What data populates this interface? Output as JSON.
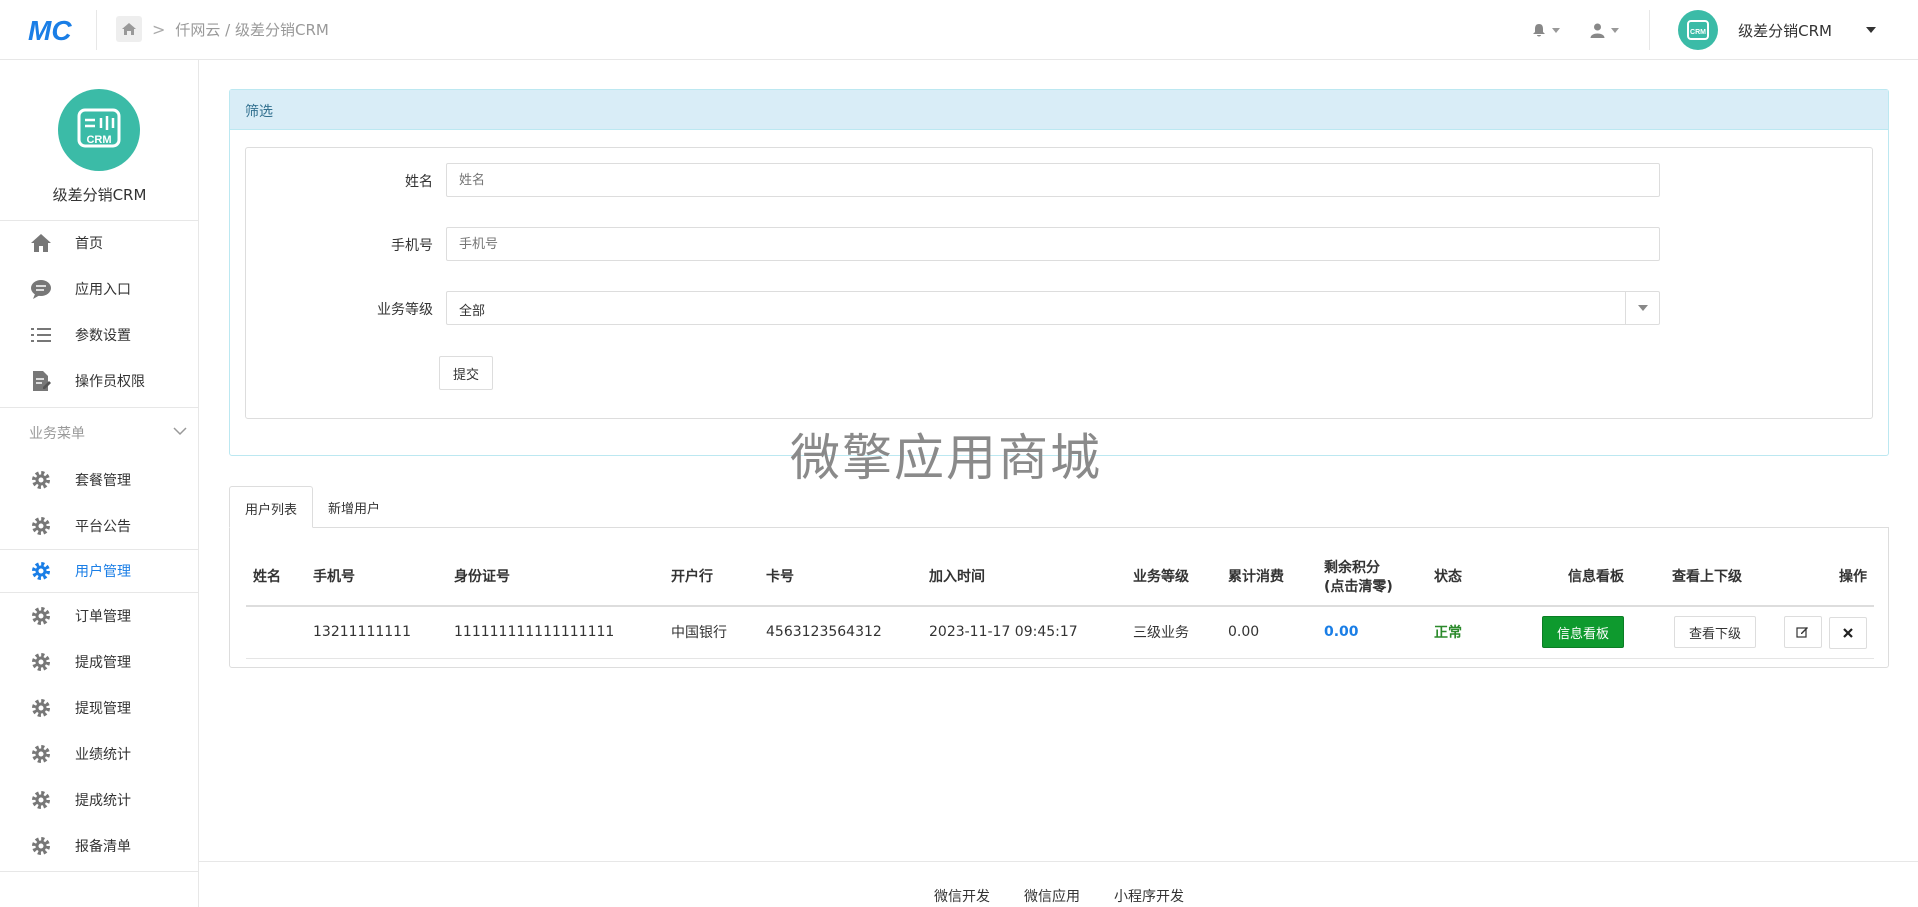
{
  "header": {
    "breadcrumb": "仟网云 / 级差分销CRM",
    "user_name": "级差分销CRM"
  },
  "sidebar": {
    "brand_name": "级差分销CRM",
    "top_items": [
      {
        "label": "首页",
        "icon": "home-icon"
      },
      {
        "label": "应用入口",
        "icon": "chat-icon"
      },
      {
        "label": "参数设置",
        "icon": "list-icon"
      },
      {
        "label": "操作员权限",
        "icon": "document-icon"
      }
    ],
    "group_label": "业务菜单",
    "items": [
      {
        "label": "套餐管理",
        "icon": "gear-icon"
      },
      {
        "label": "平台公告",
        "icon": "gear-icon"
      },
      {
        "label": "用户管理",
        "icon": "gear-icon",
        "active": true
      },
      {
        "label": "订单管理",
        "icon": "gear-icon"
      },
      {
        "label": "提成管理",
        "icon": "gear-icon"
      },
      {
        "label": "提现管理",
        "icon": "gear-icon"
      },
      {
        "label": "业绩统计",
        "icon": "gear-icon"
      },
      {
        "label": "提成统计",
        "icon": "gear-icon"
      },
      {
        "label": "报备清单",
        "icon": "gear-icon"
      }
    ]
  },
  "filter": {
    "title": "筛选",
    "name_label": "姓名",
    "name_placeholder": "姓名",
    "phone_label": "手机号",
    "phone_placeholder": "手机号",
    "level_label": "业务等级",
    "level_value": "全部",
    "submit_label": "提交"
  },
  "watermark": "微擎应用商城",
  "tabs": [
    {
      "label": "用户列表",
      "active": true
    },
    {
      "label": "新增用户",
      "active": false
    }
  ],
  "table": {
    "columns": [
      "姓名",
      "手机号",
      "身份证号",
      "开户行",
      "卡号",
      "加入时间",
      "业务等级",
      "累计消费",
      "剩余积分",
      "(点击清零)",
      "状态",
      "信息看板",
      "查看上下级",
      "操作"
    ],
    "rows": [
      {
        "name": "",
        "phone": "13211111111",
        "id_card": "111111111111111111",
        "bank": "中国银行",
        "card": "4563123564312",
        "joined": "2023-11-17 09:45:17",
        "level": "三级业务",
        "consumption": "0.00",
        "points": "0.00",
        "status": "正常",
        "dashboard_btn": "信息看板",
        "relations_btn": "查看下级"
      }
    ]
  },
  "footer": {
    "links": [
      "微信开发",
      "微信应用",
      "小程序开发"
    ]
  },
  "colors": {
    "accent": "#1a7ee6",
    "brand_teal": "#3bbba7",
    "panel_head": "#d9edf7",
    "green_button": "#0e9a2e"
  }
}
